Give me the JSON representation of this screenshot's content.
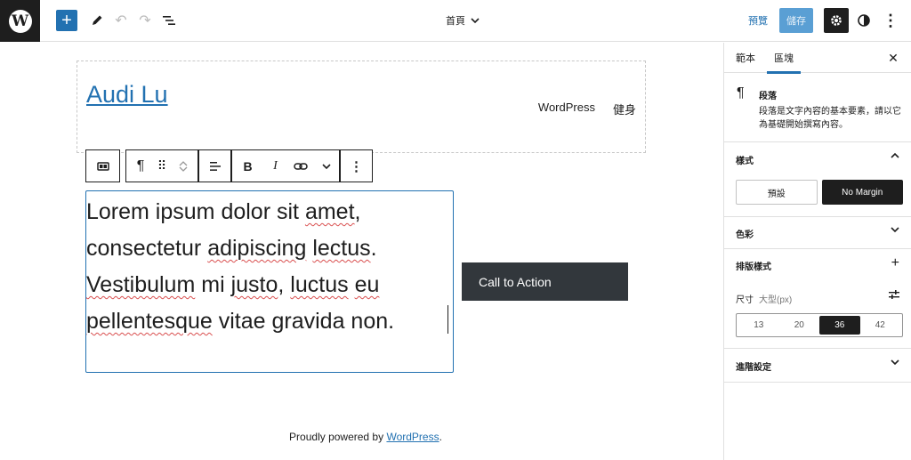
{
  "topbar": {
    "logo": "W",
    "add_label": "+",
    "undo_glyph": "↶",
    "redo_glyph": "↷",
    "document_title": "首頁",
    "preview_label": "預覽",
    "save_label": "儲存",
    "more_glyph": "⋮",
    "icons": [
      "wordpress-logo",
      "plus-icon",
      "pencil-icon",
      "undo-icon",
      "redo-icon",
      "list-view-icon",
      "chevron-down-icon",
      "gear-icon",
      "half-circle-icon",
      "more-vertical-icon"
    ]
  },
  "site": {
    "title": "Audi Lu",
    "nav": [
      "WordPress",
      "健身"
    ]
  },
  "block_toolbar": {
    "paragraph_glyph": "¶",
    "drag_glyph": "⠿",
    "bold": "B",
    "italic": "I",
    "more_glyph": "⋮"
  },
  "paragraph": {
    "lines": [
      [
        "Lorem ipsum dolor sit ",
        {
          "w": "amet"
        },
        ","
      ],
      [
        "consectetur ",
        {
          "w": "adipiscing"
        },
        " ",
        {
          "w": "lectus"
        },
        "."
      ],
      [
        {
          "w": "Vestibulum"
        },
        " mi ",
        {
          "w": "justo"
        },
        ", ",
        {
          "w": "luctus"
        },
        " ",
        {
          "w": "eu"
        }
      ],
      [
        {
          "w": "pellentesque"
        },
        " vitae gravida non."
      ]
    ]
  },
  "cta": {
    "label": "Call to Action"
  },
  "footer": {
    "prefix": "Proudly powered by ",
    "link": "WordPress",
    "suffix": "."
  },
  "sidebar": {
    "tabs": [
      "範本",
      "區塊"
    ],
    "active_tab": "區塊",
    "close_glyph": "✕",
    "block": {
      "icon_glyph": "¶",
      "name": "段落",
      "description": "段落是文字內容的基本要素，請以它為基礎開始撰寫內容。"
    },
    "styles": {
      "title": "樣式",
      "options": [
        "預設",
        "No Margin"
      ],
      "selected": "No Margin"
    },
    "color": {
      "title": "色彩"
    },
    "typography": {
      "title": "排版樣式",
      "size_label": "尺寸",
      "size_value": "大型(px)",
      "sizes": [
        "13",
        "20",
        "36",
        "42"
      ],
      "selected_size": "36"
    },
    "advanced": {
      "title": "進階設定"
    }
  },
  "colors": {
    "accent": "#2271b1",
    "dark": "#1e1e1e",
    "cta_bg": "#32373c",
    "save_bg": "#5a9fd4"
  }
}
